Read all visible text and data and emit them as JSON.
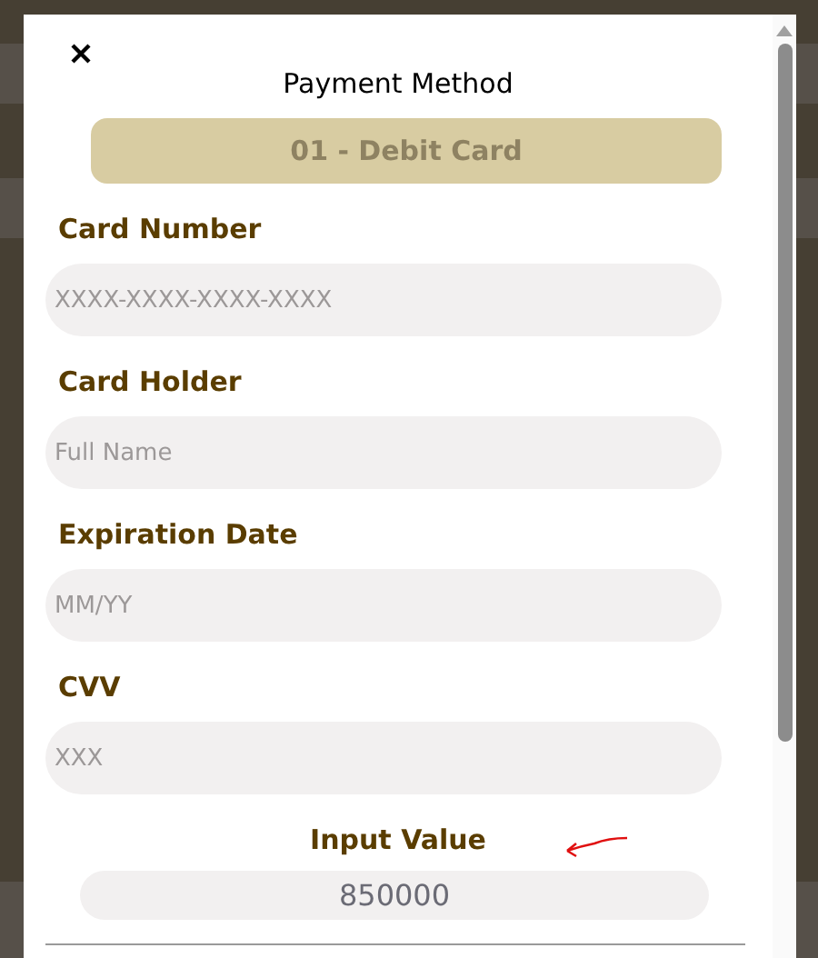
{
  "modal": {
    "title": "Payment Method",
    "payment_method": {
      "value": "01 - Debit Card"
    },
    "fields": [
      {
        "label": "Card Number",
        "placeholder": "XXXX-XXXX-XXXX-XXXX"
      },
      {
        "label": "Card Holder",
        "placeholder": "Full Name"
      },
      {
        "label": "Expiration Date",
        "placeholder": "MM/YY"
      },
      {
        "label": "CVV",
        "placeholder": "XXX"
      }
    ],
    "input_value": {
      "label": "Input Value",
      "value": "850000"
    }
  }
}
